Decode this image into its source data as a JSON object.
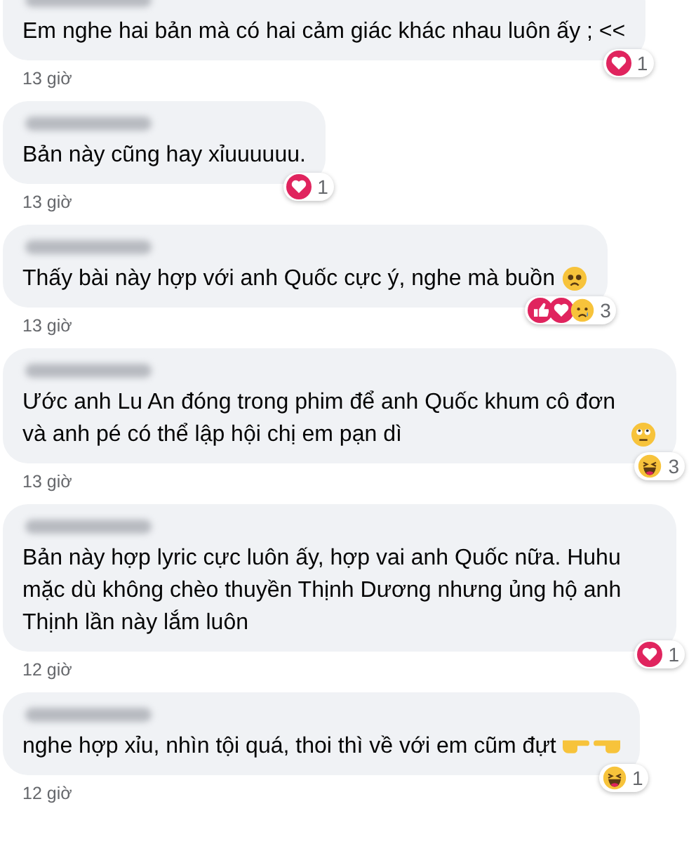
{
  "comments": [
    {
      "name_blurred": true,
      "text": "Em nghe hai bản mà có hai cảm giác khác nhau luôn ấy ; <<",
      "reactions": [
        {
          "kind": "love"
        }
      ],
      "reaction_count": "1",
      "time": "13 giờ"
    },
    {
      "name_blurred": true,
      "text": "Bản này cũng hay xỉuuuuuu.",
      "reactions": [
        {
          "kind": "love"
        }
      ],
      "reaction_count": "1",
      "time": "13 giờ"
    },
    {
      "name_blurred": true,
      "text": "Thấy bài này hợp với anh Quốc cực ý, nghe mà buồn",
      "emojis": [
        {
          "kind": "teary"
        }
      ],
      "reactions": [
        {
          "kind": "like"
        },
        {
          "kind": "love"
        },
        {
          "kind": "sad"
        }
      ],
      "reaction_count": "3",
      "time": "13 giờ"
    },
    {
      "name_blurred": true,
      "text": "Ước anh Lu An đóng trong phim để anh Quốc khum cô đơn và anh pé có thể lập hội chị em pạn dì",
      "emojis": [
        {
          "kind": "eyeroll"
        }
      ],
      "reactions": [
        {
          "kind": "haha"
        }
      ],
      "reaction_count": "3",
      "time": "13 giờ"
    },
    {
      "name_blurred": true,
      "text": "Bản này hợp lyric cực luôn ấy, hợp vai anh Quốc nữa. Huhu mặc dù không chèo thuyền Thịnh Dương nhưng ủng hộ anh Thịnh lần này lắm luôn",
      "reactions": [
        {
          "kind": "love"
        }
      ],
      "reaction_count": "1",
      "time": "12 giờ"
    },
    {
      "name_blurred": true,
      "text": "nghe hợp xỉu, nhìn tội quá, thoi thì về với em cũm đựt",
      "emojis": [
        {
          "kind": "point-right"
        },
        {
          "kind": "point-left"
        }
      ],
      "reactions": [
        {
          "kind": "haha"
        }
      ],
      "reaction_count": "1",
      "time": "12 giờ"
    }
  ]
}
